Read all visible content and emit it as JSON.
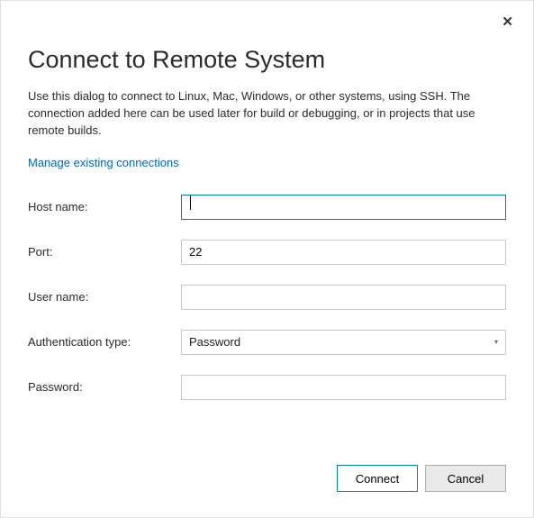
{
  "dialog": {
    "title": "Connect to Remote System",
    "description": "Use this dialog to connect to Linux, Mac, Windows, or other systems, using SSH. The connection added here can be used later for build or debugging, or in projects that use remote builds.",
    "manage_link": "Manage existing connections"
  },
  "form": {
    "hostname_label": "Host name:",
    "hostname_value": "",
    "port_label": "Port:",
    "port_value": "22",
    "username_label": "User name:",
    "username_value": "",
    "authtype_label": "Authentication type:",
    "authtype_value": "Password",
    "password_label": "Password:",
    "password_value": ""
  },
  "buttons": {
    "connect": "Connect",
    "cancel": "Cancel"
  }
}
